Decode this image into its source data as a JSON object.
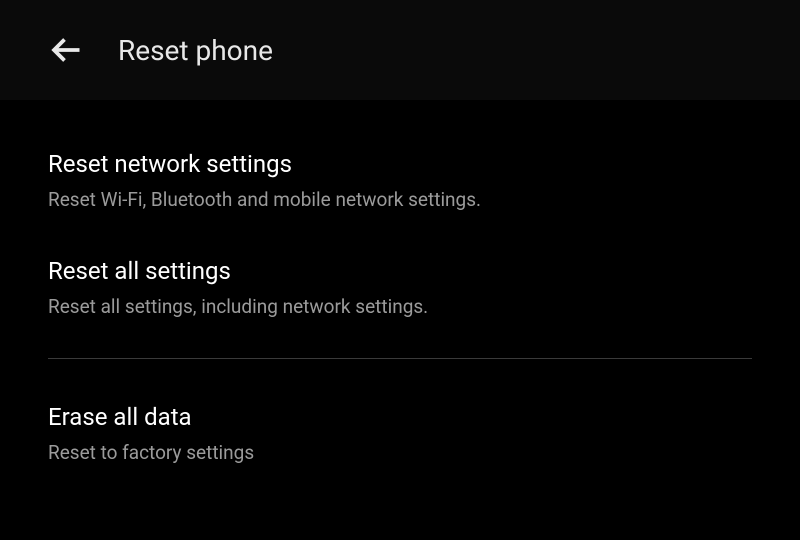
{
  "header": {
    "title": "Reset phone"
  },
  "items": [
    {
      "title": "Reset network settings",
      "subtitle": "Reset Wi-Fi, Bluetooth and mobile network settings."
    },
    {
      "title": "Reset all settings",
      "subtitle": "Reset all settings, including network settings."
    },
    {
      "title": "Erase all data",
      "subtitle": "Reset to factory settings"
    }
  ]
}
